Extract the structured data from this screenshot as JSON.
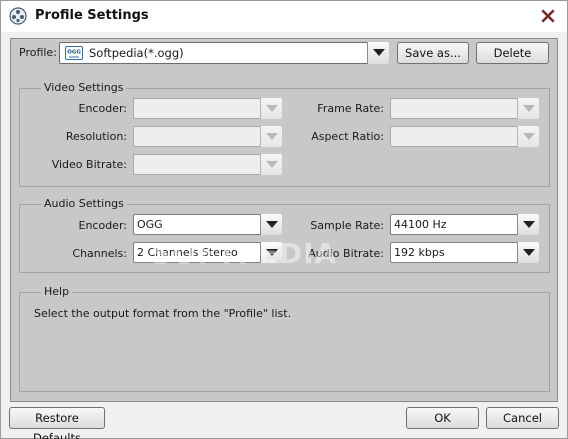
{
  "window": {
    "title": "Profile Settings"
  },
  "profile": {
    "label": "Profile:",
    "selected": "Softpedia(*.ogg)",
    "save_as_label": "Save as...",
    "delete_label": "Delete"
  },
  "video": {
    "title": "Video Settings",
    "encoder_label": "Encoder:",
    "resolution_label": "Resolution:",
    "bitrate_label": "Video Bitrate:",
    "frame_rate_label": "Frame Rate:",
    "aspect_ratio_label": "Aspect Ratio:",
    "encoder_value": "",
    "resolution_value": "",
    "bitrate_value": "",
    "frame_rate_value": "",
    "aspect_ratio_value": ""
  },
  "audio": {
    "title": "Audio Settings",
    "encoder_label": "Encoder:",
    "channels_label": "Channels:",
    "sample_rate_label": "Sample Rate:",
    "bitrate_label": "Audio Bitrate:",
    "encoder_value": "OGG",
    "channels_value": "2 Channels Stereo",
    "sample_rate_value": "44100 Hz",
    "bitrate_value": "192 kbps"
  },
  "help": {
    "title": "Help",
    "text": "Select the output format from the \"Profile\" list."
  },
  "footer": {
    "restore_label": "Restore Defaults",
    "ok_label": "OK",
    "cancel_label": "Cancel"
  },
  "watermark": "SOFTPEDIA",
  "colors": {
    "content_bg": "#c8c8c8",
    "window_bg": "#f0f0f0",
    "close_icon": "#7a2a2a"
  }
}
